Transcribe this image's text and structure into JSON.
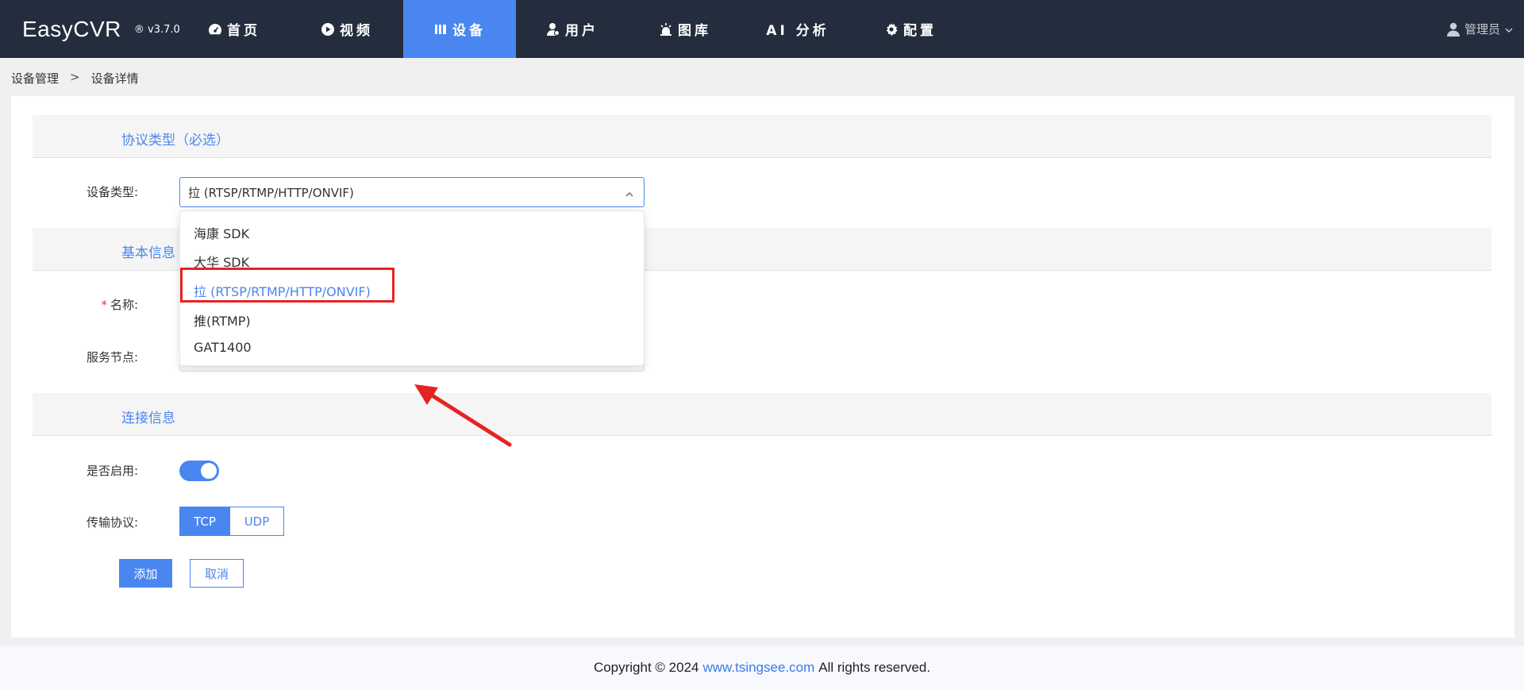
{
  "app": {
    "name": "EasyCVR",
    "version": "® v3.7.0"
  },
  "nav": {
    "items": [
      {
        "label": "首页",
        "icon": "dashboard-icon"
      },
      {
        "label": "视频",
        "icon": "play-icon"
      },
      {
        "label": "设备",
        "icon": "device-icon",
        "active": true
      },
      {
        "label": "用户",
        "icon": "user-icon"
      },
      {
        "label": "图库",
        "icon": "gallery-icon"
      },
      {
        "label": "AI 分析",
        "icon": ""
      },
      {
        "label": "配置",
        "icon": "gear-icon"
      }
    ],
    "user": "管理员"
  },
  "breadcrumb": {
    "parent": "设备管理",
    "separator": ">",
    "current": "设备详情"
  },
  "sections": {
    "protocol": "协议类型（必选）",
    "basic": "基本信息",
    "connection": "连接信息"
  },
  "form": {
    "device_type_label": "设备类型:",
    "device_type_value": "拉 (RTSP/RTMP/HTTP/ONVIF)",
    "name_required": "*",
    "name_label": "名称:",
    "service_node_label": "服务节点:",
    "enable_label": "是否启用:",
    "enable_on": true,
    "transport_label": "传输协议:",
    "transport_options": [
      "TCP",
      "UDP"
    ],
    "transport_selected": "TCP"
  },
  "dropdown": {
    "options": [
      "海康 SDK",
      "大华 SDK",
      "拉 (RTSP/RTMP/HTTP/ONVIF)",
      "推(RTMP)",
      "GAT1400"
    ],
    "selected": "拉 (RTSP/RTMP/HTTP/ONVIF)"
  },
  "buttons": {
    "add": "添加",
    "cancel": "取消"
  },
  "footer": {
    "prefix": "Copyright © 2024",
    "link": "www.tsingsee.com",
    "suffix": "All rights reserved."
  },
  "colors": {
    "nav_bg": "#232d3d",
    "accent": "#4a86f0",
    "annotation": "#e62323"
  }
}
